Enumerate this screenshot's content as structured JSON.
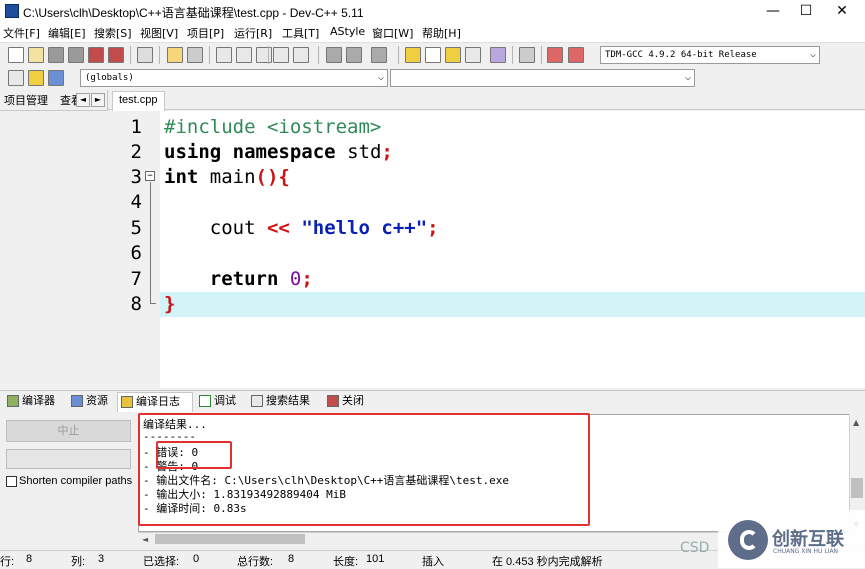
{
  "window": {
    "title": "C:\\Users\\clh\\Desktop\\C++语言基础课程\\test.cpp - Dev-C++ 5.11",
    "minimize": "—",
    "maximize": "☐",
    "close": "✕"
  },
  "menu": [
    "文件[F]",
    "编辑[E]",
    "搜索[S]",
    "视图[V]",
    "项目[P]",
    "运行[R]",
    "工具[T]",
    "AStyle",
    "窗口[W]",
    "帮助[H]"
  ],
  "toolbar": {
    "compiler_select": "TDM-GCC 4.9.2 64-bit Release",
    "scope_select": "(globals)"
  },
  "left_panel": {
    "tab_project": "项目管理",
    "tab_class": "查看类",
    "arrow_left": "◄",
    "arrow_right": "►"
  },
  "editor": {
    "file_tab": "test.cpp",
    "line_numbers": [
      "1",
      "2",
      "3",
      "4",
      "5",
      "6",
      "7",
      "8"
    ],
    "fold_marker": "−",
    "code": {
      "l1": "#include <iostream>",
      "l2_kw1": "using",
      "l2_kw2": "namespace",
      "l2_id": "std",
      "l2_semi": ";",
      "l3_kw": "int",
      "l3_id": "main",
      "l3_op": "(){",
      "l5_id": "cout",
      "l5_op": "<<",
      "l5_str": "\"hello c++\"",
      "l5_semi": ";",
      "l7_kw": "return",
      "l7_num": "0",
      "l7_semi": ";",
      "l8_op": "}"
    }
  },
  "bottom_tabs": [
    "编译器",
    "资源",
    "编译日志",
    "调试",
    "搜索结果",
    "关闭"
  ],
  "compile_panel": {
    "stop_button": "中止",
    "shorten_paths": "Shorten compiler paths",
    "log_lines": [
      "编译结果...",
      "--------",
      "- 错误: 0",
      "- 警告: 0",
      "- 输出文件名: C:\\Users\\clh\\Desktop\\C++语言基础课程\\test.exe",
      "- 输出大小: 1.83193492889404 MiB",
      "- 编译时间: 0.83s"
    ],
    "scroll_up": "▲",
    "scroll_down": "▼",
    "scroll_left": "◄",
    "scroll_right": "►"
  },
  "statusbar": {
    "row_label": "行:",
    "row": "8",
    "col_label": "列:",
    "col": "3",
    "sel_label": "已选择:",
    "sel": "0",
    "total_label": "总行数:",
    "total": "8",
    "len_label": "长度:",
    "len": "101",
    "mode": "插入",
    "parse": "在 0.453 秒内完成解析"
  },
  "watermark": {
    "text": "创新互联",
    "sub": "CHUANG XIN HU LIAN",
    "csd": "CSD"
  }
}
